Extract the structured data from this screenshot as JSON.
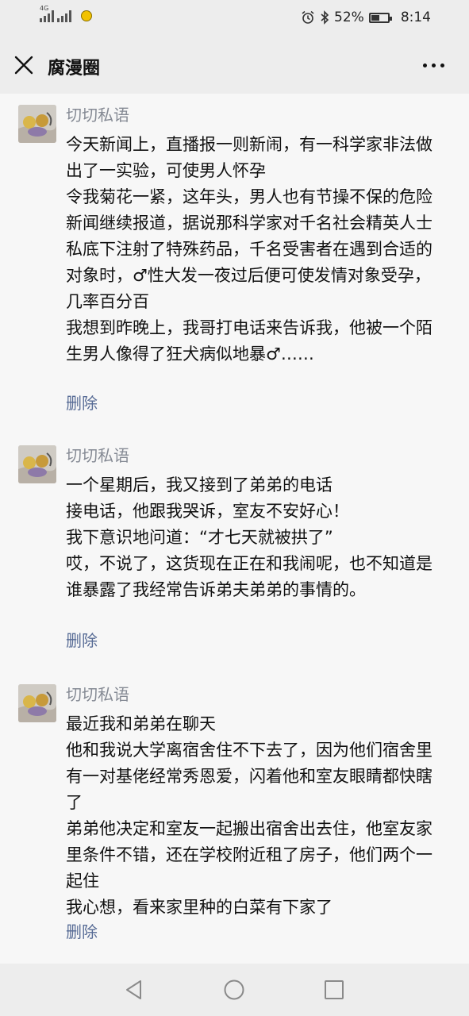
{
  "status_bar": {
    "net_label": "4G",
    "battery": "52%",
    "battery_level": 0.52,
    "time": "8:14"
  },
  "header": {
    "title": "腐漫圈"
  },
  "posts": [
    {
      "author": "切切私语",
      "lines": [
        "今天新闻上，直播报一则新闹，有一科学家非法做出了一实验，可使男人怀孕",
        "令我菊花一紧，这年头，男人也有节操不保的危险",
        "新闻继续报道，据说那科学家对千名社会精英人士私底下注射了特殊药品，千名受害者在遇到合适的对象时，♂性大发一夜过后便可使发情对象受孕，几率百分百",
        "我想到昨晚上，我哥打电话来告诉我，他被一个陌生男人像得了狂犬病似地暴♂……"
      ],
      "delete_label": "删除"
    },
    {
      "author": "切切私语",
      "lines": [
        "一个星期后，我又接到了弟弟的电话",
        "接电话，他跟我哭诉，室友不安好心！",
        "我下意识地问道：“才七天就被拱了”",
        "哎，不说了，这货现在正在和我闹呢，也不知道是谁暴露了我经常告诉弟夫弟弟的事情的。"
      ],
      "delete_label": "删除"
    },
    {
      "author": "切切私语",
      "lines": [
        "最近我和弟弟在聊天",
        "他和我说大学离宿舍住不下去了，因为他们宿舍里有一对基佬经常秀恩爱，闪着他和室友眼睛都快瞎了",
        "弟弟他决定和室友一起搬出宿舍出去住，他室友家里条件不错，还在学校附近租了房子，他们两个一起住",
        "我心想，看来家里种的白菜有下家了"
      ],
      "delete_label": "删除"
    }
  ]
}
